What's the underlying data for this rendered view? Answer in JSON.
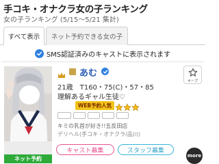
{
  "header": {
    "title": "手コキ・オナクラ女の子ランキング",
    "subtitle": "女の子ランキング (5/15〜5/21 集計)"
  },
  "tabs": [
    {
      "label": "すべて表示",
      "active": true
    },
    {
      "label": "ネット予約できる女の子",
      "active": false
    }
  ],
  "sms_banner": {
    "text": "SMS認証済みのキャストに表示されます"
  },
  "card": {
    "name": "あむ",
    "profile": "21歳　T160・75(C)・57・85",
    "catchphrase": "理解あるギャル生徒♡",
    "popular_label": "WEB予約人気",
    "popular_stars": 3,
    "comment": "キミの乳首が好き!!五反田店",
    "shop": "デリヘル(手コキ・オナクラ/品川)",
    "keep_label": "キープ",
    "net_reserve_label": "ネット予約",
    "cast_recruit_label": "キャスト募集",
    "staff_recruit_label": "スタッフ募集",
    "more_label": "more"
  },
  "colors": {
    "name": "#2d5fb5",
    "net_badge": "#2eaa3a",
    "cast_button": "#e7508f",
    "staff_button": "#35b5d8",
    "verify": "#2f80e0",
    "popular": "#f2c31b"
  },
  "icons": [
    "crown-icon",
    "new-icon",
    "verified-badge-icon",
    "star-icon",
    "check-circle-icon"
  ]
}
